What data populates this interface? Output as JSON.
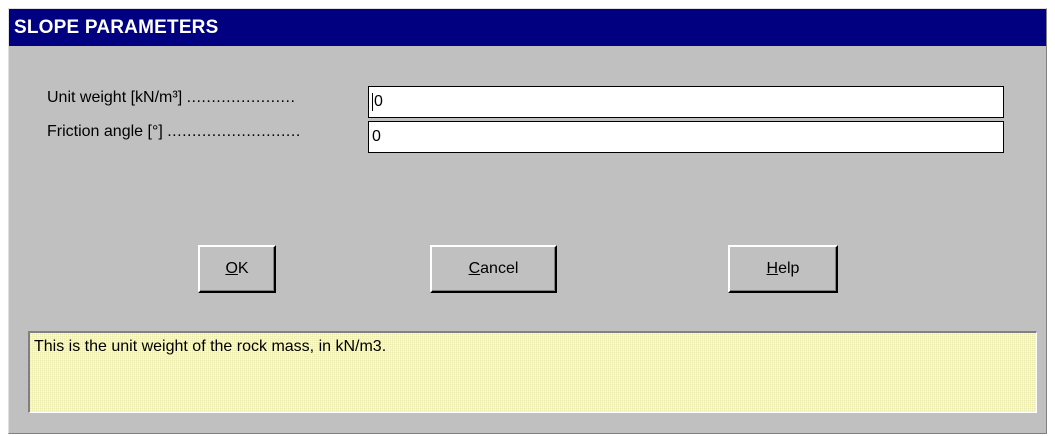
{
  "dialog": {
    "title": "SLOPE PARAMETERS"
  },
  "fields": [
    {
      "label": "Unit weight [kN/m³]",
      "dots": "......................",
      "value": "0"
    },
    {
      "label": "Friction angle [°]",
      "dots": "...........................",
      "value": "0"
    }
  ],
  "buttons": {
    "ok": {
      "mnemonic": "O",
      "rest": "K"
    },
    "cancel": {
      "mnemonic": "C",
      "rest": "ancel"
    },
    "help": {
      "mnemonic": "H",
      "rest": "elp"
    }
  },
  "help_text": "This is the unit weight of the rock mass, in kN/m3."
}
